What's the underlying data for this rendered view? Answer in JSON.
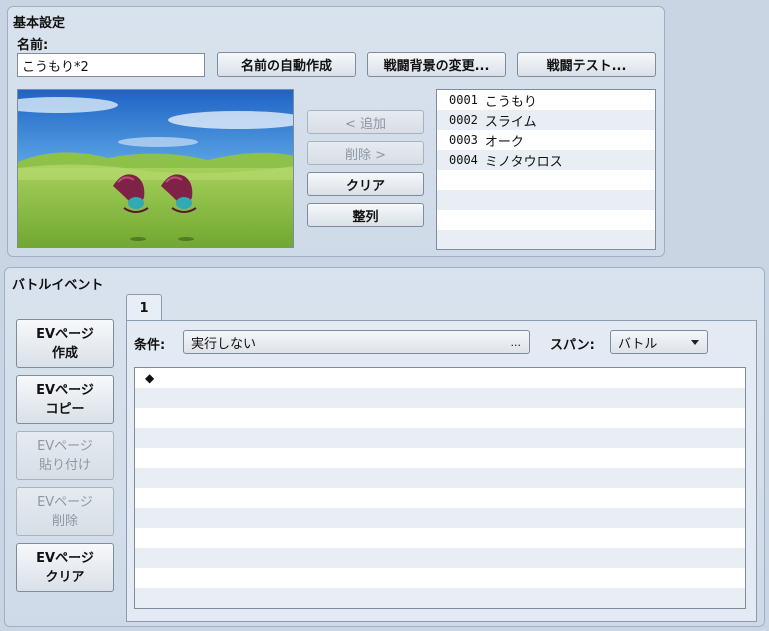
{
  "basic": {
    "title": "基本設定",
    "name_label": "名前:",
    "name_value": "こうもり*2",
    "auto_name_button": "名前の自動作成",
    "change_bg_button": "戦闘背景の変更...",
    "battle_test_button": "戦闘テスト...",
    "add_button": "< 追加",
    "remove_button": "削除 >",
    "clear_button": "クリア",
    "sort_button": "整列",
    "enemies": [
      {
        "id": "0001",
        "name": "こうもり"
      },
      {
        "id": "0002",
        "name": "スライム"
      },
      {
        "id": "0003",
        "name": "オーク"
      },
      {
        "id": "0004",
        "name": "ミノタウロス"
      }
    ]
  },
  "event": {
    "title": "バトルイベント",
    "page_buttons": [
      {
        "line1": "EVページ",
        "line2": "作成",
        "enabled": true
      },
      {
        "line1": "EVページ",
        "line2": "コピー",
        "enabled": true
      },
      {
        "line1": "EVページ",
        "line2": "貼り付け",
        "enabled": false
      },
      {
        "line1": "EVページ",
        "line2": "削除",
        "enabled": false
      },
      {
        "line1": "EVページ",
        "line2": "クリア",
        "enabled": true
      }
    ],
    "tab_label": "1",
    "condition_label": "条件:",
    "condition_value": "実行しない",
    "condition_ellipsis": "...",
    "span_label": "スパン:",
    "span_value": "バトル",
    "command_marker": "◆"
  },
  "colors": {
    "panel_bg": "#d9e3ee",
    "border": "#7f8c9b",
    "row_alt": "#e9eef4"
  }
}
